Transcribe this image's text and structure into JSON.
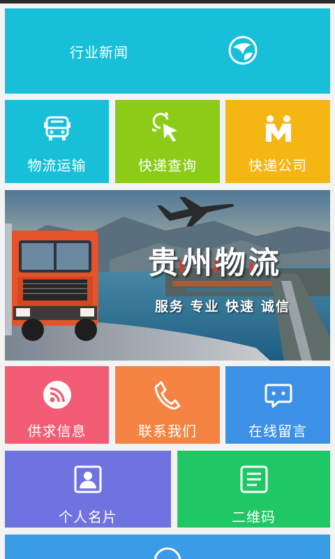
{
  "tiles": {
    "industry_news": {
      "label": "行业新闻",
      "color": "#17c0d8",
      "icon": "globe-icon"
    },
    "logistics": {
      "label": "物流运输",
      "color": "#17c0d8",
      "icon": "bus-icon"
    },
    "express_query": {
      "label": "快递查询",
      "color": "#8ccc19",
      "icon": "cursor-click-icon"
    },
    "express_company": {
      "label": "快递公司",
      "color": "#f5b614",
      "icon": "people-icon"
    },
    "supply_demand": {
      "label": "供求信息",
      "color": "#f25c75",
      "icon": "rss-icon"
    },
    "contact_us": {
      "label": "联系我们",
      "color": "#f58442",
      "icon": "phone-icon"
    },
    "online_message": {
      "label": "在线留言",
      "color": "#3c91e6",
      "icon": "chat-icon"
    },
    "business_card": {
      "label": "个人名片",
      "color": "#6f73e0",
      "icon": "contact-card-icon"
    },
    "qr_code": {
      "label": "二维码",
      "color": "#1fc765",
      "icon": "document-icon"
    },
    "bottom_partial": {
      "color": "#3a9be6",
      "icon": "globe-icon"
    }
  },
  "banner": {
    "title": "贵州物流",
    "subtitle": "服务 专业 快速 诚信"
  }
}
